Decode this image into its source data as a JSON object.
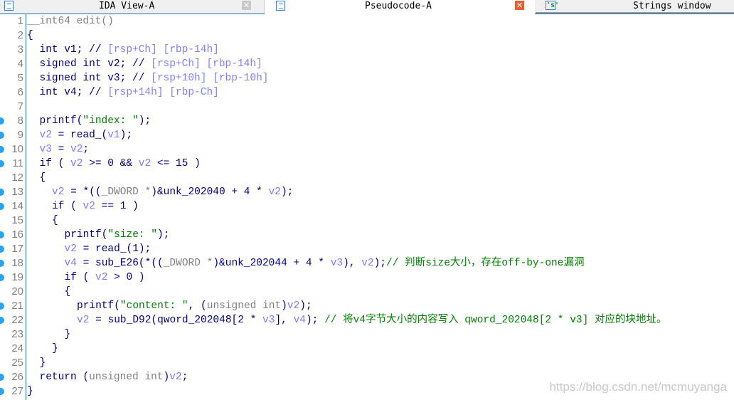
{
  "tabs": [
    {
      "label": "IDA View-A",
      "icon": "disassembly-icon"
    },
    {
      "label": "Pseudocode-A",
      "icon": "pseudocode-icon",
      "active": true
    },
    {
      "label": "Strings window",
      "icon": "strings-icon",
      "icon_text": "'s'"
    }
  ],
  "colors": {
    "keyword": "#000080",
    "variable": "#7a7aff",
    "comment_addr": "#8080ff",
    "string": "#008000",
    "type": "#808080",
    "breakpoint_dot": "#29a3f5"
  },
  "watermark": "https://blog.csdn.net/mcmuyanga",
  "lines": [
    {
      "num": "1",
      "dot": false,
      "indent": 0,
      "tokens": [
        [
          "g",
          "__int64 edit()"
        ]
      ]
    },
    {
      "num": "2",
      "dot": false,
      "indent": 0,
      "tokens": [
        [
          "k",
          "{"
        ]
      ]
    },
    {
      "num": "3",
      "dot": false,
      "indent": 1,
      "tokens": [
        [
          "k",
          "int v1; // "
        ],
        [
          "c",
          "[rsp+Ch] [rbp-14h]"
        ]
      ]
    },
    {
      "num": "4",
      "dot": false,
      "indent": 1,
      "tokens": [
        [
          "k",
          "signed int v2; // "
        ],
        [
          "c",
          "[rsp+Ch] [rbp-14h]"
        ]
      ]
    },
    {
      "num": "5",
      "dot": false,
      "indent": 1,
      "tokens": [
        [
          "k",
          "signed int v3; // "
        ],
        [
          "c",
          "[rsp+10h] [rbp-10h]"
        ]
      ]
    },
    {
      "num": "6",
      "dot": false,
      "indent": 1,
      "tokens": [
        [
          "k",
          "int v4; // "
        ],
        [
          "c",
          "[rsp+14h] [rbp-Ch]"
        ]
      ]
    },
    {
      "num": "7",
      "dot": false,
      "indent": 0,
      "tokens": []
    },
    {
      "num": "8",
      "dot": true,
      "indent": 1,
      "tokens": [
        [
          "k",
          "printf("
        ],
        [
          "s",
          "\"index: \""
        ],
        [
          "k",
          ");"
        ]
      ]
    },
    {
      "num": "9",
      "dot": true,
      "indent": 1,
      "tokens": [
        [
          "v",
          "v2"
        ],
        [
          "k",
          " = read_("
        ],
        [
          "v",
          "v1"
        ],
        [
          "k",
          ");"
        ]
      ]
    },
    {
      "num": "10",
      "dot": true,
      "indent": 1,
      "tokens": [
        [
          "v",
          "v3"
        ],
        [
          "k",
          " = "
        ],
        [
          "v",
          "v2"
        ],
        [
          "k",
          ";"
        ]
      ]
    },
    {
      "num": "11",
      "dot": true,
      "indent": 1,
      "tokens": [
        [
          "k",
          "if ( "
        ],
        [
          "v",
          "v2"
        ],
        [
          "k",
          " >= 0 && "
        ],
        [
          "v",
          "v2"
        ],
        [
          "k",
          " <= 15 )"
        ]
      ]
    },
    {
      "num": "12",
      "dot": false,
      "indent": 1,
      "tokens": [
        [
          "k",
          "{"
        ]
      ]
    },
    {
      "num": "13",
      "dot": true,
      "indent": 2,
      "tokens": [
        [
          "v",
          "v2"
        ],
        [
          "k",
          " = *(("
        ],
        [
          "g",
          "_DWORD *"
        ],
        [
          "k",
          ")&unk_202040 + 4 * "
        ],
        [
          "v",
          "v2"
        ],
        [
          "k",
          ");"
        ]
      ]
    },
    {
      "num": "14",
      "dot": true,
      "indent": 2,
      "tokens": [
        [
          "k",
          "if ( "
        ],
        [
          "v",
          "v2"
        ],
        [
          "k",
          " == 1 )"
        ]
      ]
    },
    {
      "num": "15",
      "dot": false,
      "indent": 2,
      "tokens": [
        [
          "k",
          "{"
        ]
      ]
    },
    {
      "num": "16",
      "dot": true,
      "indent": 3,
      "tokens": [
        [
          "k",
          "printf("
        ],
        [
          "s",
          "\"size: \""
        ],
        [
          "k",
          ");"
        ]
      ]
    },
    {
      "num": "17",
      "dot": true,
      "indent": 3,
      "tokens": [
        [
          "v",
          "v2"
        ],
        [
          "k",
          " = read_(1);"
        ]
      ]
    },
    {
      "num": "18",
      "dot": true,
      "indent": 3,
      "tokens": [
        [
          "v",
          "v4"
        ],
        [
          "k",
          " = sub_E26(*(("
        ],
        [
          "g",
          "_DWORD *"
        ],
        [
          "k",
          ")&unk_202044 + 4 * "
        ],
        [
          "v",
          "v3"
        ],
        [
          "k",
          "), "
        ],
        [
          "v",
          "v2"
        ],
        [
          "k",
          ");"
        ],
        [
          "cm",
          "// 判断size大小，存在off-by-one漏洞"
        ]
      ]
    },
    {
      "num": "19",
      "dot": true,
      "indent": 3,
      "tokens": [
        [
          "k",
          "if ( "
        ],
        [
          "v",
          "v2"
        ],
        [
          "k",
          " > 0 )"
        ]
      ]
    },
    {
      "num": "20",
      "dot": false,
      "indent": 3,
      "tokens": [
        [
          "k",
          "{"
        ]
      ]
    },
    {
      "num": "21",
      "dot": true,
      "indent": 4,
      "tokens": [
        [
          "k",
          "printf("
        ],
        [
          "s",
          "\"content: \""
        ],
        [
          "k",
          ", ("
        ],
        [
          "g",
          "unsigned int"
        ],
        [
          "k",
          ")"
        ],
        [
          "v",
          "v2"
        ],
        [
          "k",
          ");"
        ]
      ]
    },
    {
      "num": "22",
      "dot": true,
      "indent": 4,
      "tokens": [
        [
          "v",
          "v2"
        ],
        [
          "k",
          " = sub_D92(qword_202048[2 * "
        ],
        [
          "v",
          "v3"
        ],
        [
          "k",
          "], "
        ],
        [
          "v",
          "v4"
        ],
        [
          "k",
          "); "
        ],
        [
          "cm",
          "// 将v4字节大小的内容写入 qword_202048[2 * v3] 对应的块地址。"
        ]
      ]
    },
    {
      "num": "23",
      "dot": false,
      "indent": 3,
      "tokens": [
        [
          "k",
          "}"
        ]
      ]
    },
    {
      "num": "24",
      "dot": false,
      "indent": 2,
      "tokens": [
        [
          "k",
          "}"
        ]
      ]
    },
    {
      "num": "25",
      "dot": false,
      "indent": 1,
      "tokens": [
        [
          "k",
          "}"
        ]
      ]
    },
    {
      "num": "26",
      "dot": true,
      "indent": 1,
      "tokens": [
        [
          "k",
          "return ("
        ],
        [
          "g",
          "unsigned int"
        ],
        [
          "k",
          ")"
        ],
        [
          "v",
          "v2"
        ],
        [
          "k",
          ";"
        ]
      ]
    },
    {
      "num": "27",
      "dot": true,
      "indent": 0,
      "tokens": [
        [
          "k",
          "}"
        ]
      ]
    }
  ]
}
